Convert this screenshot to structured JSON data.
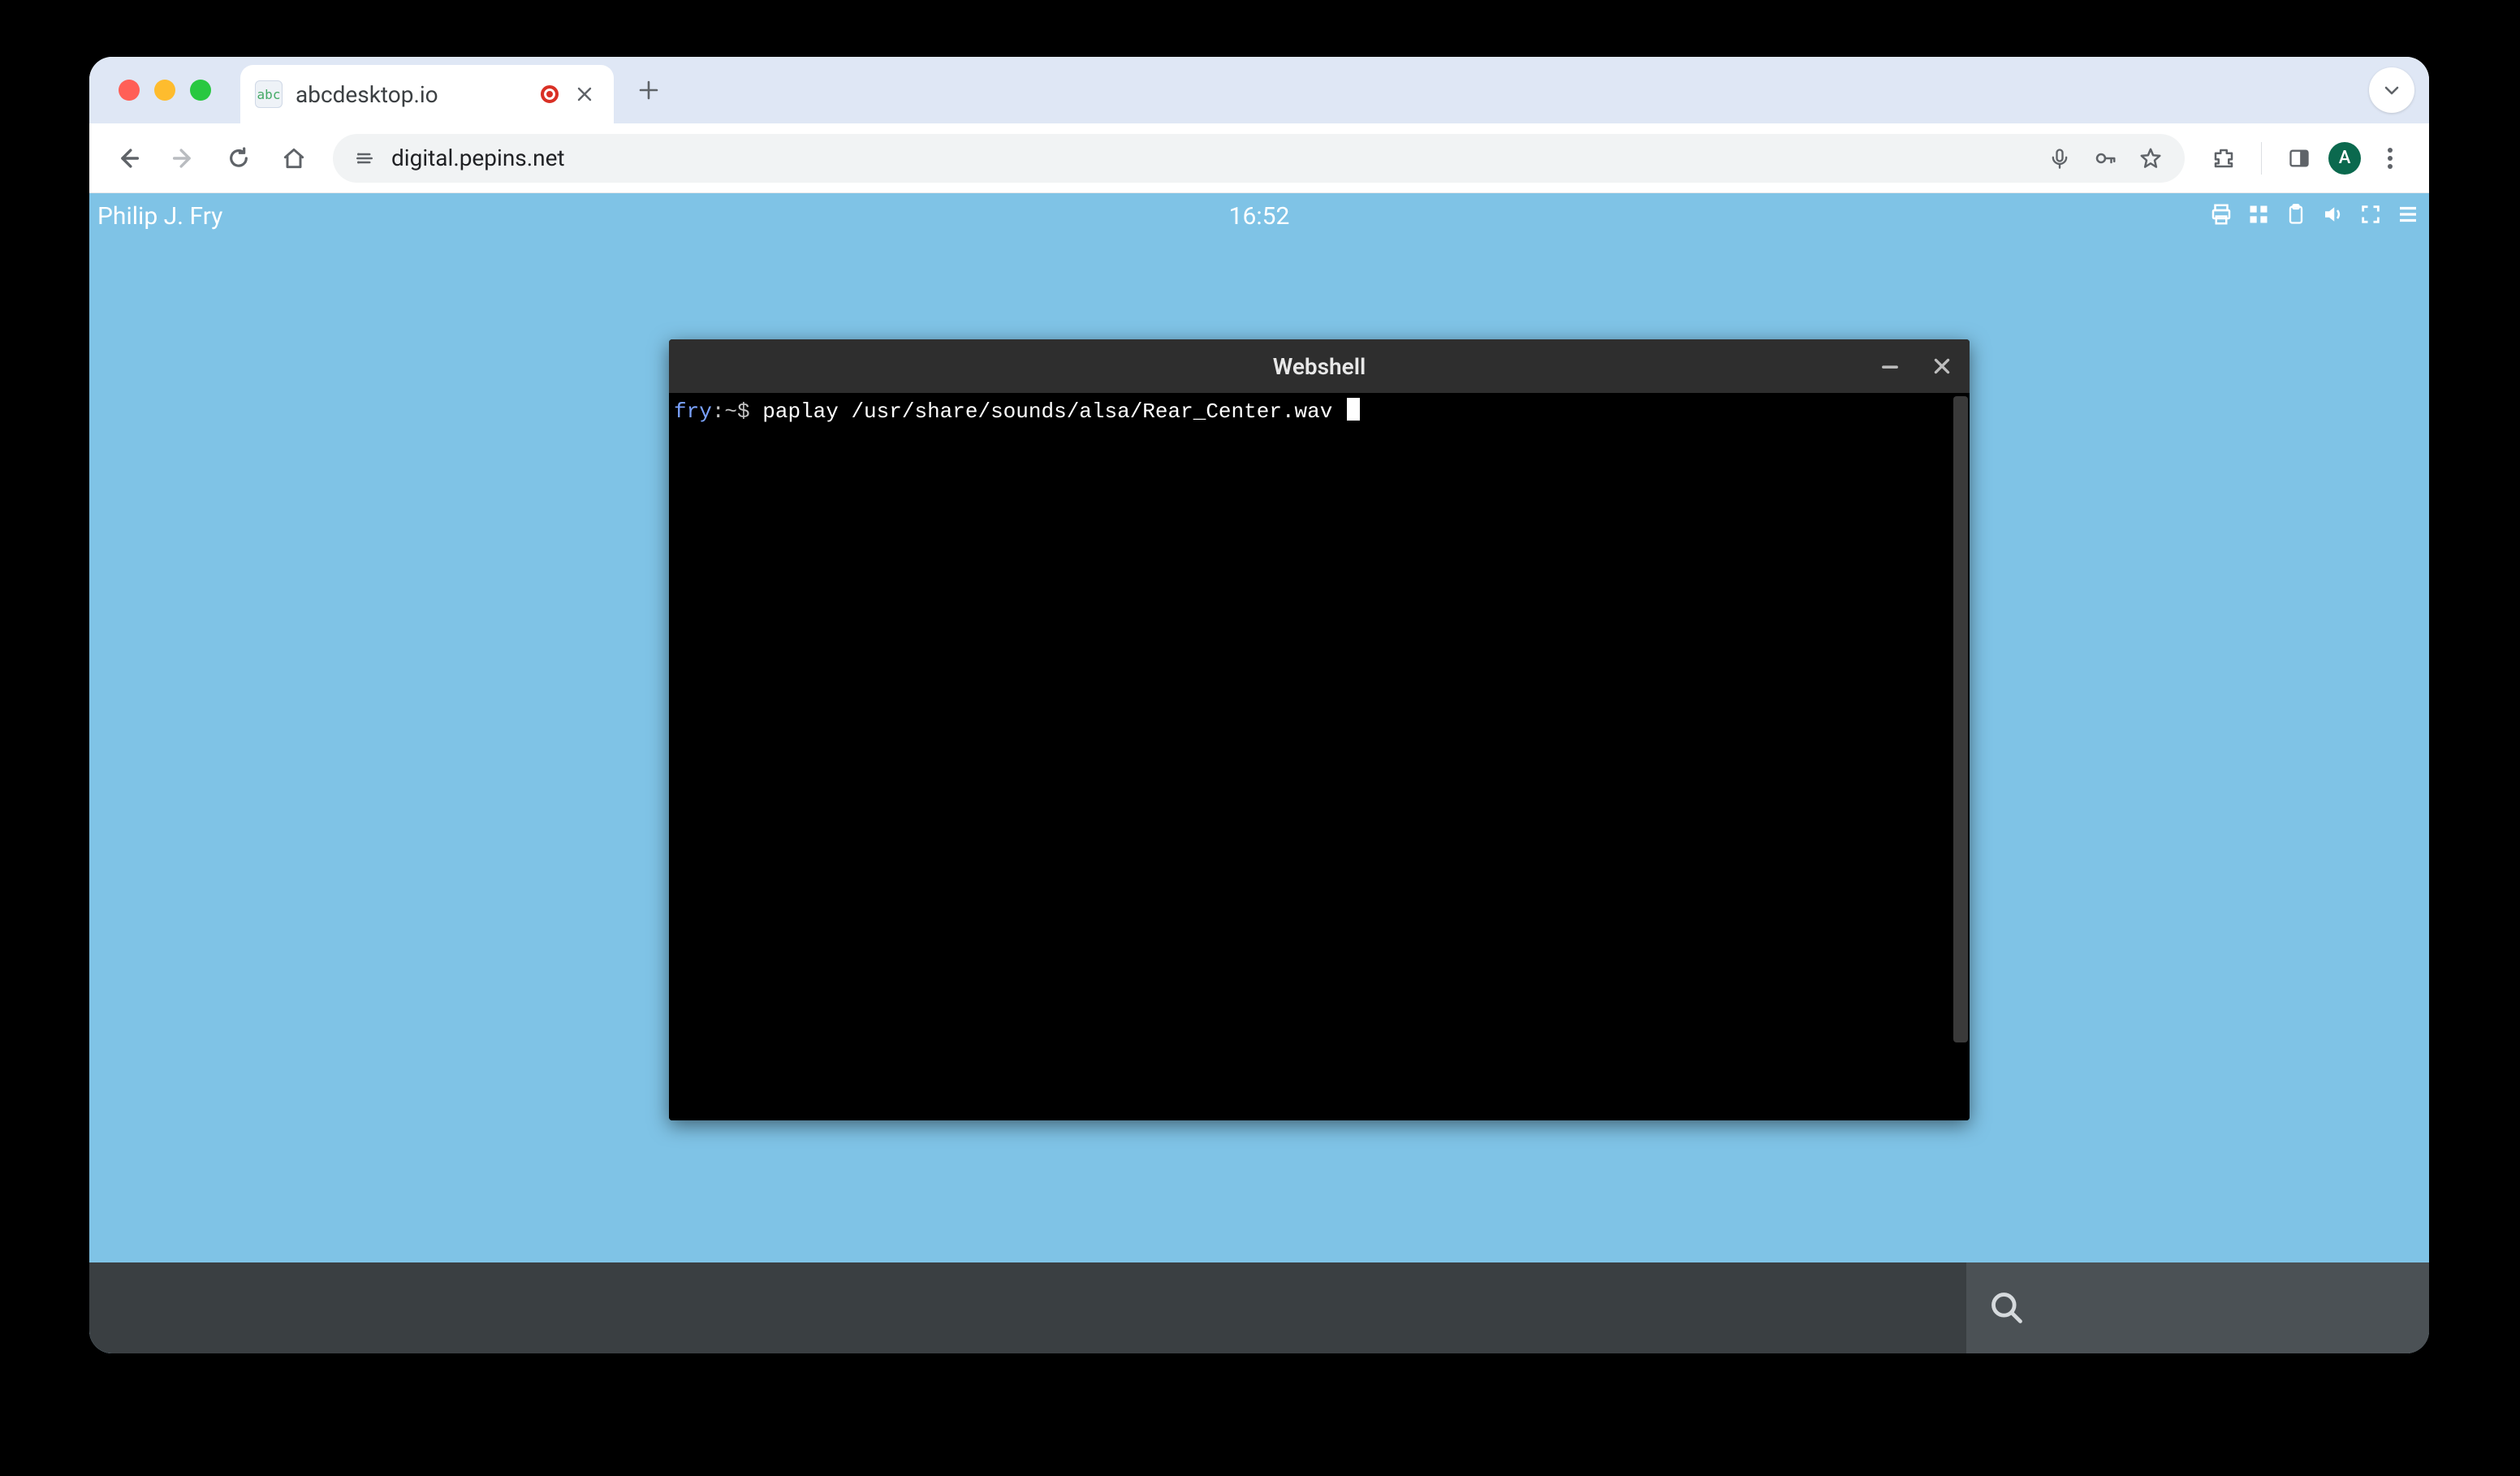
{
  "browser": {
    "tab": {
      "title": "abcdesktop.io",
      "favicon_label": "abc"
    },
    "url": {
      "full": "digital.pepins.net",
      "host": "digital.pepins.net"
    },
    "avatar_letter": "A"
  },
  "remote": {
    "username": "Philip J. Fry",
    "clock": "16:52"
  },
  "shell": {
    "title": "Webshell",
    "prompt_user": "fry",
    "prompt_sep": ":~$ ",
    "command": "paplay /usr/share/sounds/alsa/Rear_Center.wav "
  }
}
